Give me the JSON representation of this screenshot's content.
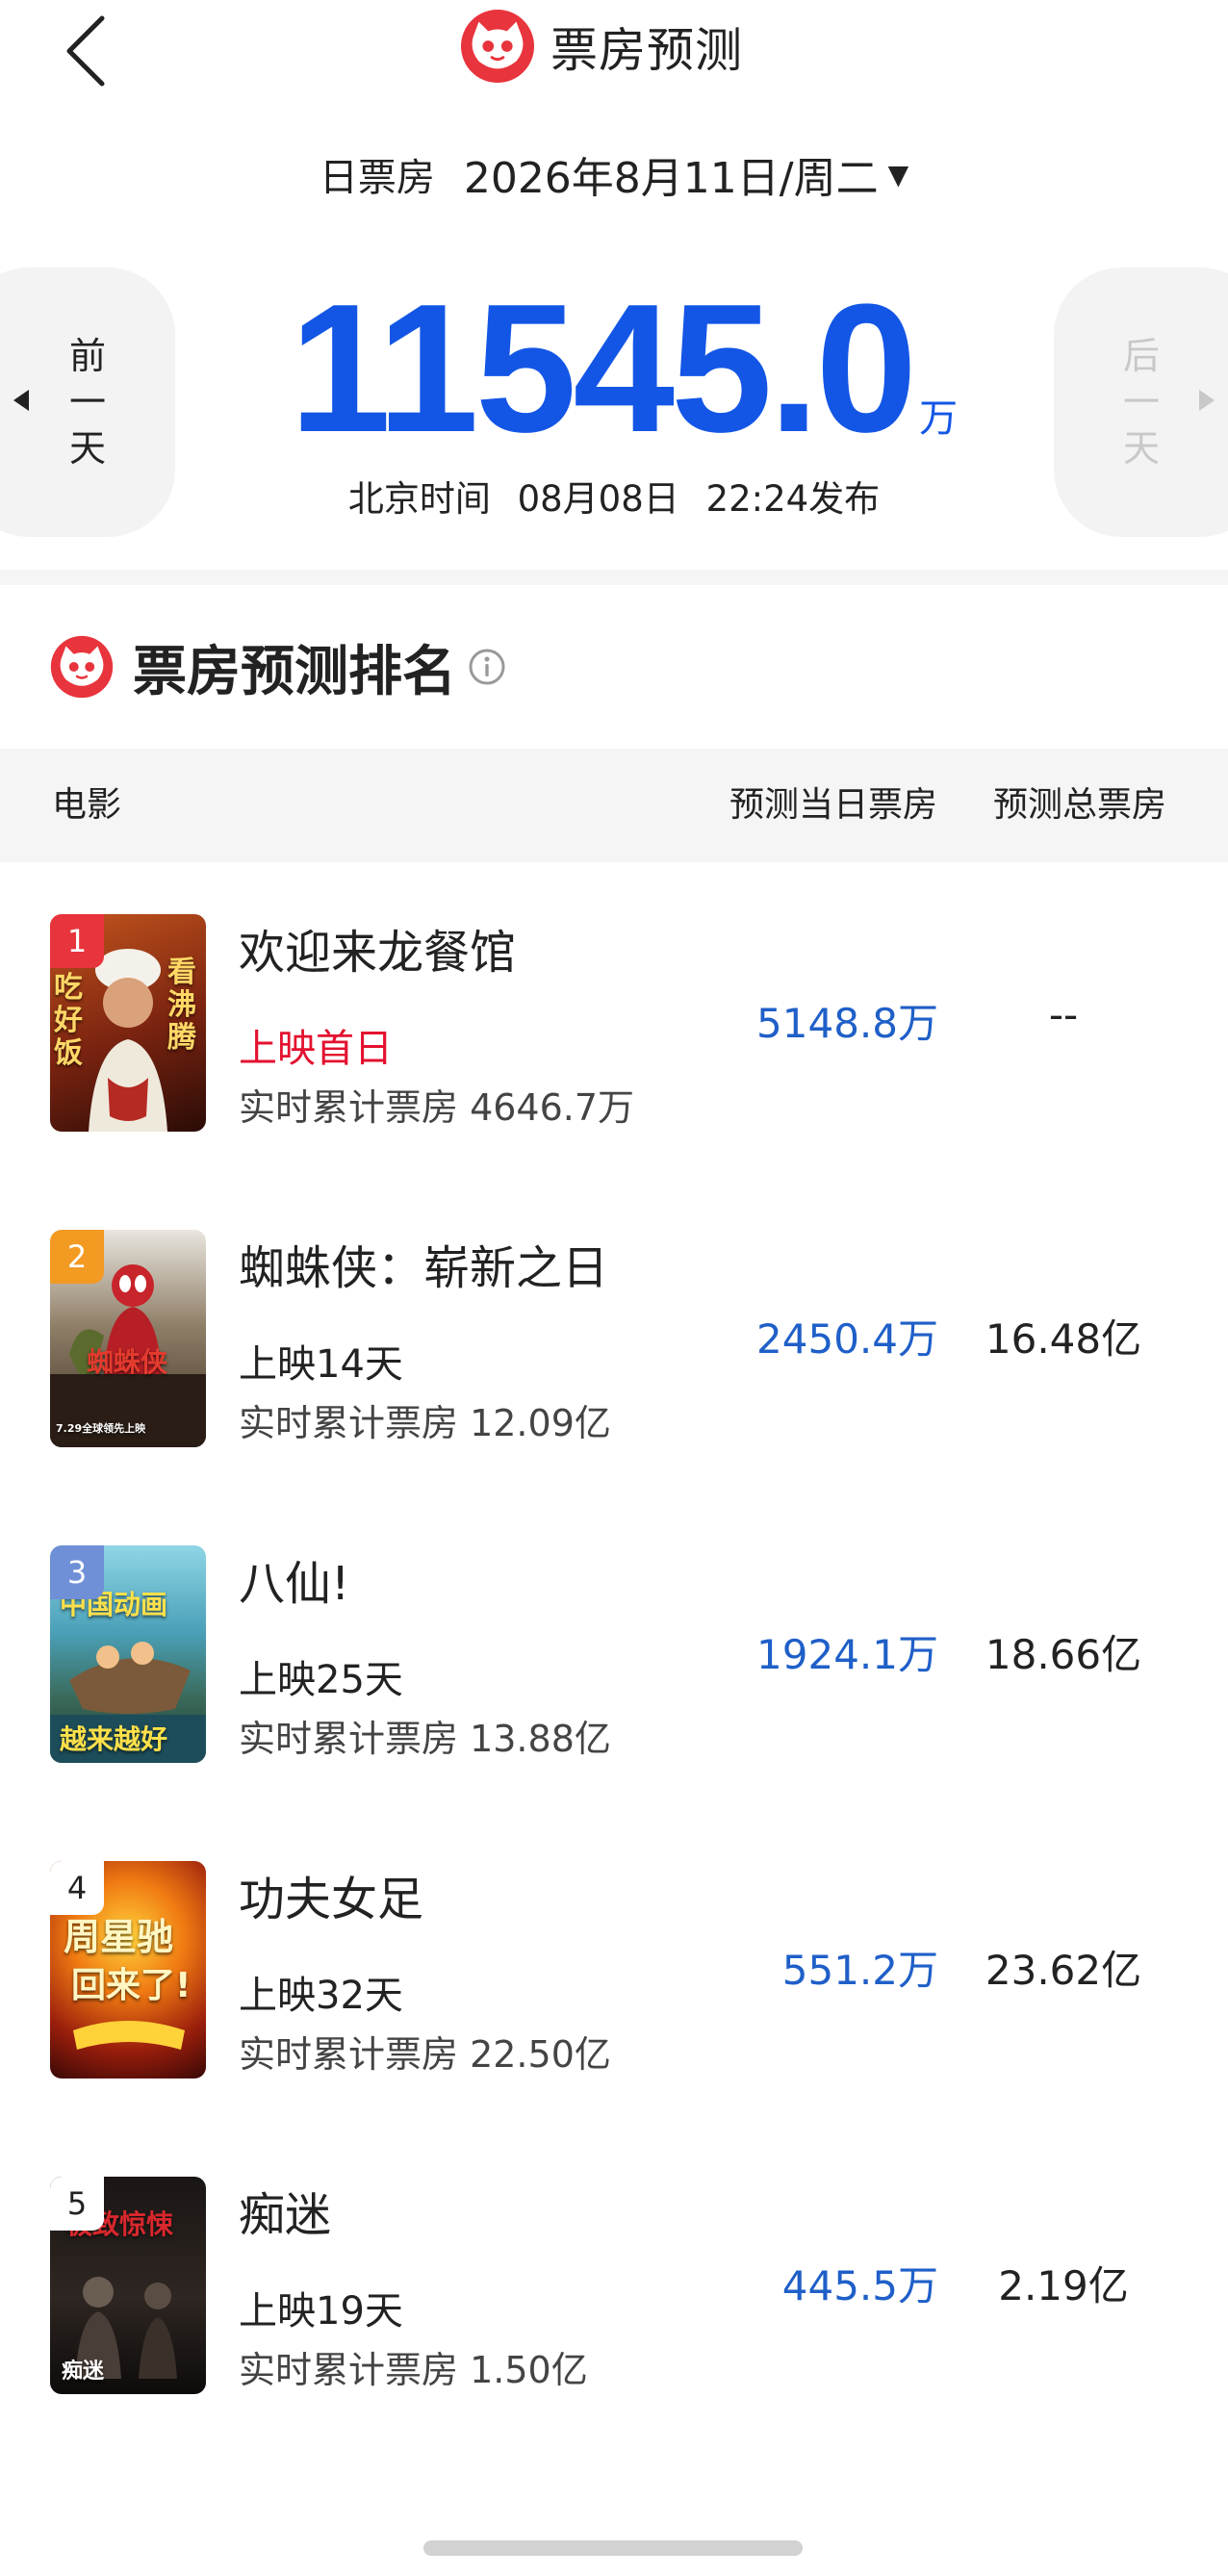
{
  "header": {
    "title": "票房预测",
    "back_icon": "chevron-left-icon"
  },
  "date_selector": {
    "type_label": "日票房",
    "date": "2026年8月11日/周二",
    "caret": "▼"
  },
  "nav": {
    "prev_day": [
      "前",
      "一",
      "天"
    ],
    "next_day": [
      "后",
      "一",
      "天"
    ]
  },
  "summary": {
    "total": "11545.0",
    "unit": "万",
    "publish_prefix": "北京时间",
    "publish_date": "08月08日",
    "publish_time": "22:24发布"
  },
  "ranking": {
    "title": "票房预测排名",
    "columns": {
      "movie": "电影",
      "day_forecast": "预测当日票房",
      "total_forecast": "预测总票房"
    },
    "movies": [
      {
        "rank": "1",
        "name": "欢迎来龙餐馆",
        "status": "上映首日",
        "cumulative": "实时累计票房 4646.7万",
        "day_forecast": "5148.8万",
        "total_forecast": "--",
        "badge_color": "#e8343c",
        "poster_text_left": "吃好饭",
        "poster_text_right": "看沸腾"
      },
      {
        "rank": "2",
        "name": "蜘蛛侠：崭新之日",
        "status": "上映14天",
        "cumulative": "实时累计票房 12.09亿",
        "day_forecast": "2450.4万",
        "total_forecast": "16.48亿",
        "badge_color": "#f39a23",
        "poster_text_left": "蜘蛛侠",
        "poster_text_right": "7.29全球领先上映"
      },
      {
        "rank": "3",
        "name": "八仙!",
        "status": "上映25天",
        "cumulative": "实时累计票房 13.88亿",
        "day_forecast": "1924.1万",
        "total_forecast": "18.66亿",
        "badge_color": "#6f8fd6",
        "poster_text_left": "中国动画",
        "poster_text_right": "越来越好"
      },
      {
        "rank": "4",
        "name": "功夫女足",
        "status": "上映32天",
        "cumulative": "实时累计票房 22.50亿",
        "day_forecast": "551.2万",
        "total_forecast": "23.62亿",
        "badge_color": "#ffffff",
        "poster_text_left": "周星驰",
        "poster_text_right": "回来了!"
      },
      {
        "rank": "5",
        "name": "痴迷",
        "status": "上映19天",
        "cumulative": "实时累计票房 1.50亿",
        "day_forecast": "445.5万",
        "total_forecast": "2.19亿",
        "badge_color": "#ffffff",
        "poster_text_left": "极致惊悚",
        "poster_text_right": "痴迷"
      }
    ]
  },
  "colors": {
    "accent_blue": "#1356e6",
    "forecast_blue": "#1f5fc8",
    "first_day_red": "#e3112f",
    "brand_red": "#e8343c"
  }
}
